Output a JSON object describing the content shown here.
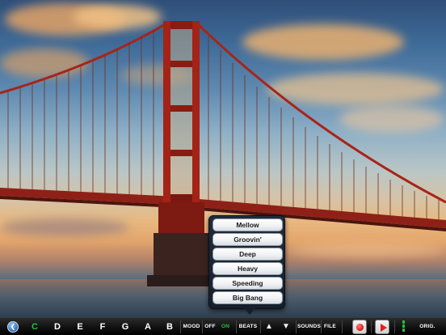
{
  "mood_menu": {
    "options": [
      "Mellow",
      "Groovin'",
      "Deep",
      "Heavy",
      "Speeding",
      "Big Bang"
    ]
  },
  "toolbar": {
    "back_icon": "chevron-left-icon",
    "keys": [
      "C",
      "D",
      "E",
      "F",
      "G",
      "A",
      "B"
    ],
    "selected_key": "C",
    "mood_label": "MOOD",
    "off_label": "OFF",
    "on_label": "ON",
    "beats_label": "BEATS",
    "up_icon": "▲",
    "down_icon": "▼",
    "sounds_label": "SOUNDS",
    "file_label": "FILE",
    "record_icon": "record-icon",
    "play_icon": "play-icon",
    "orig_sounds_label": "ORIG. SOUNDS",
    "active_color": "#22c23a"
  }
}
